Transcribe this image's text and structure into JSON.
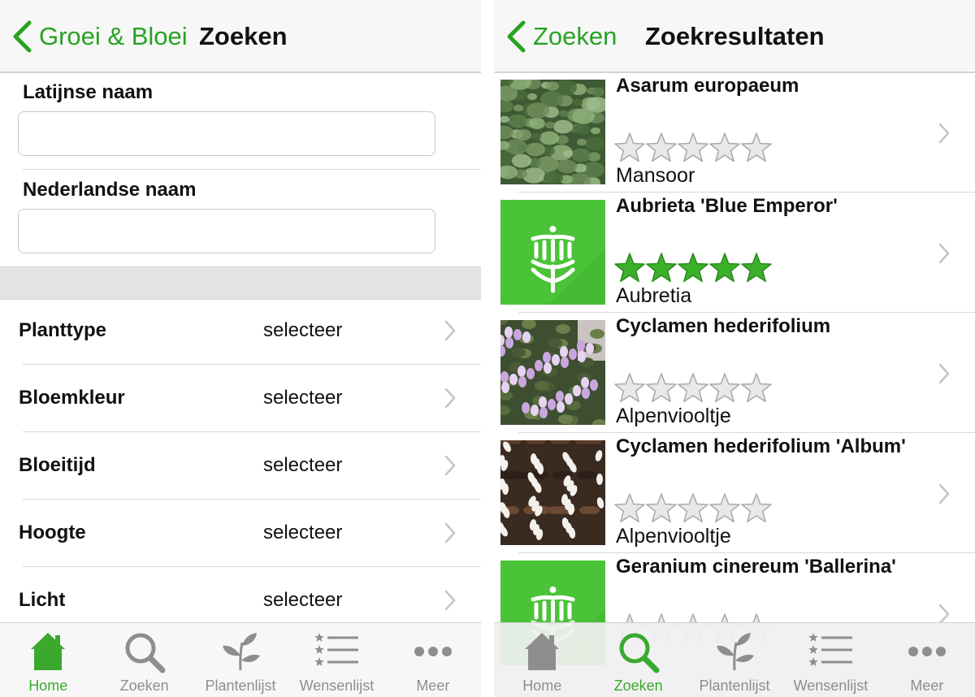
{
  "left": {
    "nav": {
      "back_label": "Groei & Bloei",
      "title": "Zoeken"
    },
    "fields": [
      {
        "label": "Latijnse naam",
        "value": "",
        "placeholder": ""
      },
      {
        "label": "Nederlandse naam",
        "value": "",
        "placeholder": ""
      }
    ],
    "filters": [
      {
        "label": "Planttype",
        "value": "selecteer"
      },
      {
        "label": "Bloemkleur",
        "value": "selecteer"
      },
      {
        "label": "Bloeitijd",
        "value": "selecteer"
      },
      {
        "label": "Hoogte",
        "value": "selecteer"
      },
      {
        "label": "Licht",
        "value": "selecteer"
      }
    ]
  },
  "right": {
    "nav": {
      "back_label": "Zoeken",
      "title": "Zoekresultaten"
    },
    "results": [
      {
        "latin": "Asarum europaeum",
        "dutch": "Mansoor",
        "rating": 0,
        "thumb": "photo-green-leaves"
      },
      {
        "latin": "Aubrieta 'Blue Emperor'",
        "dutch": "Aubretia",
        "rating": 5,
        "thumb": "app-logo-placeholder"
      },
      {
        "latin": "Cyclamen hederifolium",
        "dutch": "Alpenviooltje",
        "rating": 0,
        "thumb": "photo-pink-cyclamen"
      },
      {
        "latin": "Cyclamen hederifolium 'Album'",
        "dutch": "Alpenviooltje",
        "rating": 0,
        "thumb": "photo-white-cyclamen"
      },
      {
        "latin": "Geranium cinereum 'Ballerina'",
        "dutch": "",
        "rating": 0,
        "thumb": "app-logo-placeholder"
      }
    ]
  },
  "tabs": [
    {
      "label": "Home",
      "icon": "home-icon"
    },
    {
      "label": "Zoeken",
      "icon": "search-icon"
    },
    {
      "label": "Plantenlijst",
      "icon": "plant-icon"
    },
    {
      "label": "Wensenlijst",
      "icon": "star-list-icon"
    },
    {
      "label": "Meer",
      "icon": "more-icon"
    }
  ],
  "active_tab": {
    "left": "Home",
    "right": "Zoeken"
  },
  "colors": {
    "accent": "#28a322",
    "tab_active": "#3aa92e",
    "tab_inactive": "#8e8e8e",
    "star_filled": "#3bb029"
  }
}
